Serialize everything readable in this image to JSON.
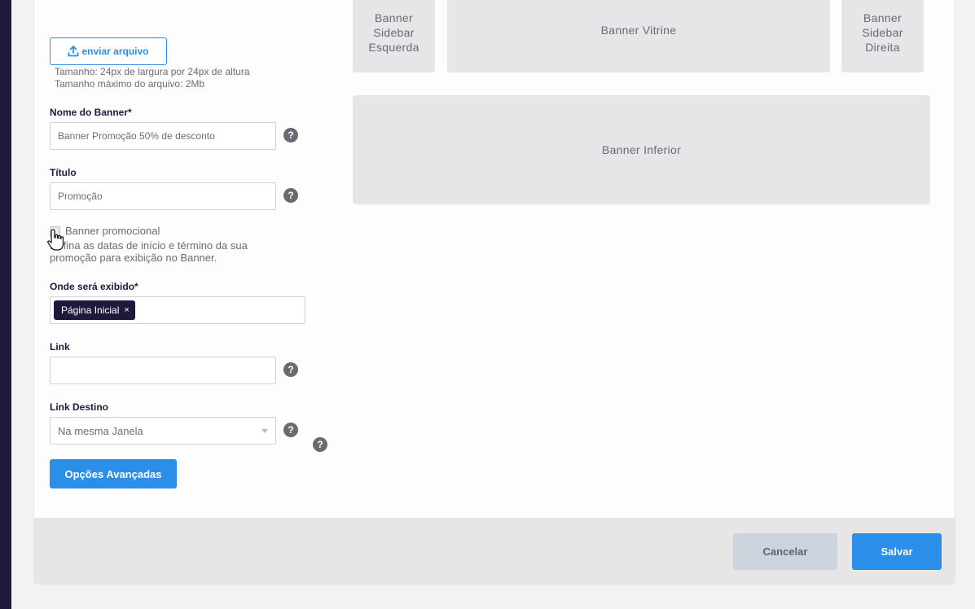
{
  "upload": {
    "button_label": "enviar arquivo",
    "hint_size": "Tamanho: 24px de largura por 24px de altura",
    "hint_max": "Tamanho máximo do arquivo: 2Mb"
  },
  "form": {
    "banner_name": {
      "label": "Nome do Banner*",
      "value": "Banner Promoção 50% de desconto"
    },
    "title": {
      "label": "Título",
      "value": "Promoção"
    },
    "promo_checkbox": {
      "label": "Banner promocional",
      "description": "Defina as datas de início e término da sua promoção para exibição no Banner.",
      "checked": false
    },
    "display_location": {
      "label": "Onde será exibido*",
      "tags": [
        "Página Inicial"
      ],
      "remove_glyph": "×"
    },
    "link": {
      "label": "Link",
      "value": ""
    },
    "link_target": {
      "label": "Link Destino",
      "selected": "Na mesma Janela"
    },
    "help_glyph": "?",
    "advanced_button": "Opções Avançadas"
  },
  "banners": {
    "sidebar_left": "Banner Sidebar Esquerda",
    "vitrine": "Banner Vitrine",
    "sidebar_right": "Banner Sidebar Direita",
    "inferior": "Banner Inferior"
  },
  "footer": {
    "cancel": "Cancelar",
    "save": "Salvar"
  },
  "colors": {
    "accent": "#2b8ee8",
    "dark": "#1f1a3d",
    "banner_placeholder": "#e6e6e8",
    "cancel_bg": "#ccd5dd"
  }
}
